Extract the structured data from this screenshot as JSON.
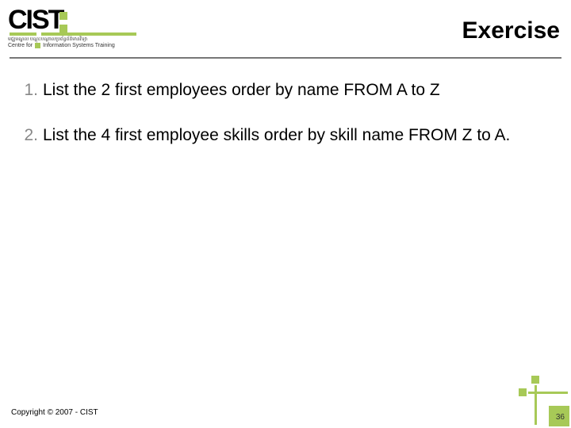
{
  "header": {
    "logo_text": "CIST",
    "logo_sub1": "មជ្ឈមណ្ឌល បណ្តុះបណ្តាលប្រព័ន្ធព័ត៌មានវិទ្យា",
    "logo_sub2_left": "Centre for",
    "logo_sub2_right": "Information Systems Training",
    "title": "Exercise"
  },
  "items": [
    {
      "num": "1.",
      "text": "List the 2 first employees order by name FROM A to Z"
    },
    {
      "num": "2.",
      "text": "List the 4 first employee skills order by skill name FROM Z to A."
    }
  ],
  "footer": {
    "copyright": "Copyright © 2007 - CIST",
    "page": "36"
  },
  "colors": {
    "accent": "#a7c957"
  }
}
